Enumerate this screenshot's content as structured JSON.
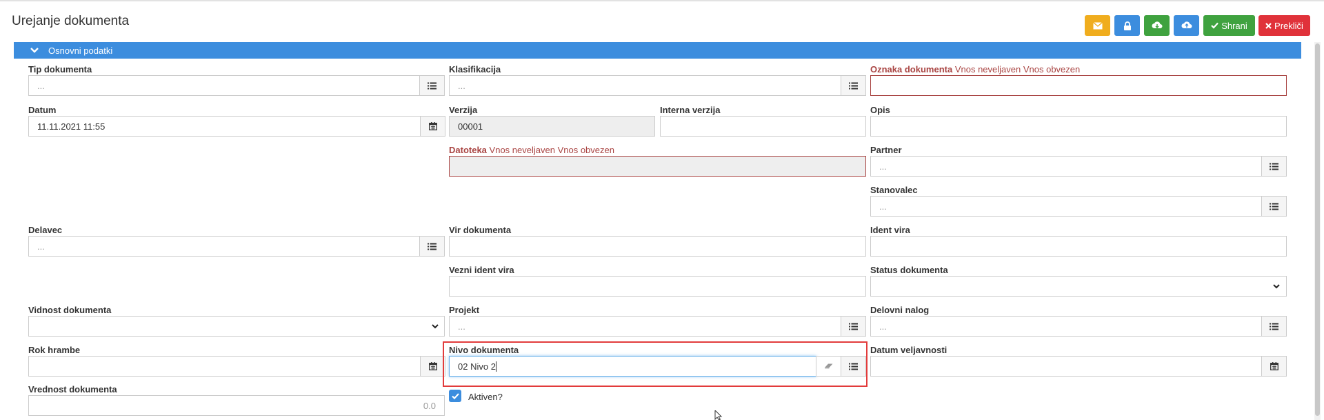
{
  "page": {
    "title": "Urejanje dokumenta"
  },
  "toolbar": {
    "buttons": [
      {
        "name": "email",
        "icon": "envelope-icon",
        "color": "#f0ad1e"
      },
      {
        "name": "lock",
        "icon": "lock-icon",
        "color": "#3c8dde"
      },
      {
        "name": "download",
        "icon": "cloud-download-icon",
        "color": "#3fa23f"
      },
      {
        "name": "upload",
        "icon": "cloud-upload-icon",
        "color": "#3c8dde"
      }
    ],
    "save_label": "Shrani",
    "cancel_label": "Prekliči",
    "save_color": "#3fa23f",
    "cancel_color": "#e0323a"
  },
  "panel": {
    "title": "Osnovni podatki",
    "color": "#3c8dde"
  },
  "errors": {
    "invalid": "Vnos neveljaven",
    "required": "Vnos obvezen"
  },
  "fields": {
    "tip_dokumenta": {
      "label": "Tip dokumenta",
      "placeholder": "..."
    },
    "klasifikacija": {
      "label": "Klasifikacija",
      "placeholder": "..."
    },
    "oznaka_dokumenta": {
      "label": "Oznaka dokumenta",
      "value": ""
    },
    "datum": {
      "label": "Datum",
      "value": "11.11.2021 11:55"
    },
    "verzija": {
      "label": "Verzija",
      "value": "00001"
    },
    "interna_verzija": {
      "label": "Interna verzija",
      "value": ""
    },
    "opis": {
      "label": "Opis",
      "value": ""
    },
    "datoteka": {
      "label": "Datoteka",
      "value": ""
    },
    "partner": {
      "label": "Partner",
      "placeholder": "..."
    },
    "stanovalec": {
      "label": "Stanovalec",
      "placeholder": "..."
    },
    "delavec": {
      "label": "Delavec",
      "placeholder": "..."
    },
    "vir_dokumenta": {
      "label": "Vir dokumenta",
      "value": ""
    },
    "ident_vira": {
      "label": "Ident vira",
      "value": ""
    },
    "vezni_ident_vira": {
      "label": "Vezni ident vira",
      "value": ""
    },
    "status_dokumenta": {
      "label": "Status dokumenta",
      "value": ""
    },
    "vidnost_dokumenta": {
      "label": "Vidnost dokumenta",
      "value": ""
    },
    "projekt": {
      "label": "Projekt",
      "placeholder": "..."
    },
    "delovni_nalog": {
      "label": "Delovni nalog",
      "placeholder": "..."
    },
    "rok_hrambe": {
      "label": "Rok hrambe",
      "value": ""
    },
    "nivo_dokumenta": {
      "label": "Nivo dokumenta",
      "value": "02 Nivo 2"
    },
    "datum_veljavnosti": {
      "label": "Datum veljavnosti",
      "value": ""
    },
    "vrednost_dokumenta": {
      "label": "Vrednost dokumenta",
      "value": "0.0"
    },
    "aktiven": {
      "label": "Aktiven?",
      "checked": true
    }
  }
}
